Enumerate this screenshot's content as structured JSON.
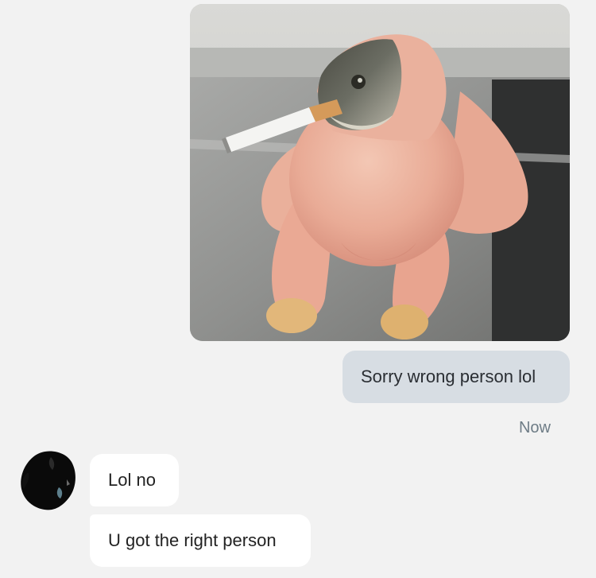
{
  "conversation": {
    "outgoing": {
      "image_icon": "meme-photo",
      "text": "Sorry wrong person lol",
      "timestamp": "Now"
    },
    "incoming": {
      "avatar_icon": "avatar",
      "messages": [
        {
          "text": "Lol no"
        },
        {
          "text": "U got the right person"
        }
      ]
    }
  },
  "colors": {
    "background": "#f2f2f2",
    "outgoing_bubble": "#d7dde3",
    "incoming_bubble": "#ffffff",
    "timestamp": "#6e7c86"
  }
}
